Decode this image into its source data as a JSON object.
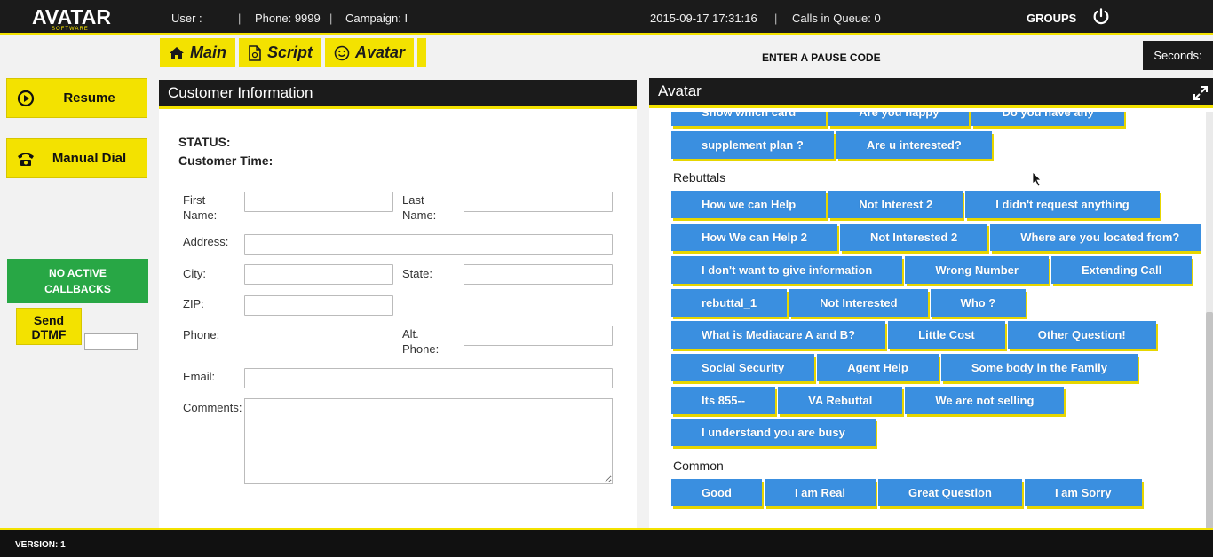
{
  "app": {
    "logo": "AVATAR",
    "logo_sub": "SOFTWARE"
  },
  "topbar": {
    "user": "User :",
    "phone": "Phone: 9999",
    "campaign": "Campaign: I",
    "datetime": "2015-09-17 17:31:16",
    "queue": "Calls in Queue: 0",
    "groups": "GROUPS"
  },
  "nav": {
    "tabs": [
      {
        "label": "Main",
        "icon": "home-icon"
      },
      {
        "label": "Script",
        "icon": "document-icon"
      },
      {
        "label": "Avatar",
        "icon": "smiley-icon"
      }
    ],
    "pause_code": "ENTER A PAUSE CODE",
    "seconds": "Seconds:"
  },
  "sidebar": {
    "resume": "Resume",
    "manual_dial": "Manual Dial",
    "callbacks_line1": "NO ACTIVE",
    "callbacks_line2": "CALLBACKS",
    "dtmf_line1": "Send",
    "dtmf_line2": "DTMF"
  },
  "customer": {
    "title": "Customer Information",
    "status": "STATUS:",
    "customer_time": "Customer Time:",
    "fields": {
      "first_name_1": "First",
      "first_name_2": "Name:",
      "last_name_1": "Last",
      "last_name_2": "Name:",
      "address": "Address:",
      "city": "City:",
      "state": "State:",
      "zip": "ZIP:",
      "phone": "Phone:",
      "alt_phone_1": "Alt.",
      "alt_phone_2": "Phone:",
      "email": "Email:",
      "comments": "Comments:"
    }
  },
  "avatar": {
    "title": "Avatar",
    "top_rows": [
      [
        "Show which card",
        "Are you happy",
        "Do you have any"
      ],
      [
        "supplement plan ?",
        "Are u interested?"
      ]
    ],
    "rebuttals_title": "Rebuttals",
    "rebuttals": [
      [
        "How we can Help",
        "Not Interest 2",
        "I didn't request anything"
      ],
      [
        "How We can Help 2",
        "Not Interested 2",
        "Where are you located from?"
      ],
      [
        "I don't want to give information",
        "Wrong Number",
        "Extending Call"
      ],
      [
        "rebuttal_1",
        "Not Interested",
        "Who ?"
      ],
      [
        "What is Mediacare A and B?",
        "Little Cost",
        "Other Question!"
      ],
      [
        "Social Security",
        "Agent Help",
        "Some body in the Family"
      ],
      [
        "Its 855--",
        "VA Rebuttal",
        "We are not selling"
      ],
      [
        "I understand you are busy"
      ]
    ],
    "common_title": "Common",
    "common": [
      [
        "Good",
        "I am Real",
        "Great Question",
        "I am Sorry"
      ]
    ]
  },
  "footer": {
    "version": "VERSION: 1"
  },
  "colors": {
    "accent": "#f3e200",
    "dark": "#1b1b1b",
    "button_blue": "#3a8fe0",
    "callbacks_green": "#28a745"
  }
}
